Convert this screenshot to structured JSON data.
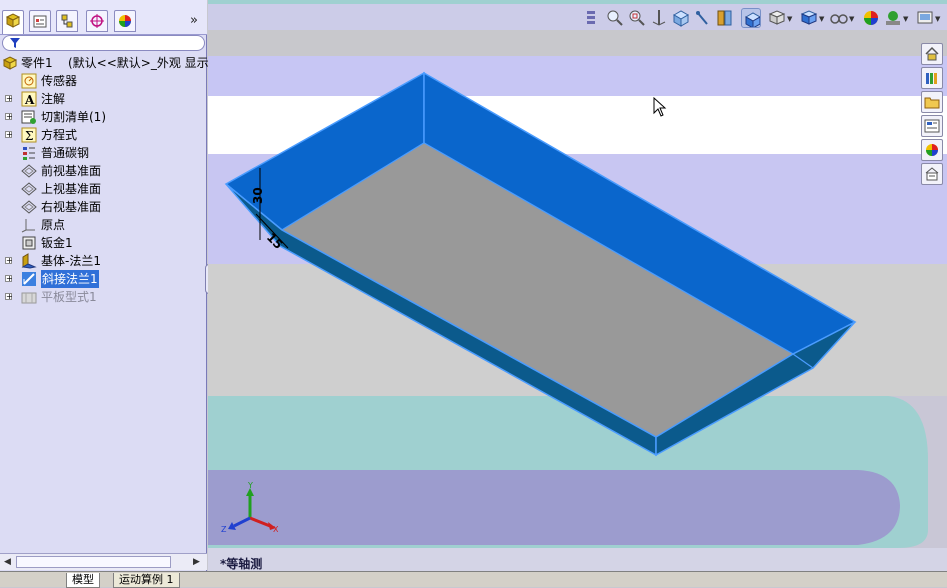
{
  "feature_tree": {
    "part_name": "零件1",
    "part_config": "(默认<<默认>_外观 显示状",
    "items": [
      {
        "label": "传感器",
        "icon": "sensor-icon"
      },
      {
        "label": "注解",
        "icon": "annotation-icon"
      },
      {
        "label": "切割清单(1)",
        "icon": "cut-list-icon"
      },
      {
        "label": "方程式",
        "icon": "equation-icon"
      },
      {
        "label": "普通碳钢",
        "icon": "material-icon"
      },
      {
        "label": "前视基准面",
        "icon": "plane-icon"
      },
      {
        "label": "上视基准面",
        "icon": "plane-icon"
      },
      {
        "label": "右视基准面",
        "icon": "plane-icon"
      },
      {
        "label": "原点",
        "icon": "origin-icon"
      },
      {
        "label": "钣金1",
        "icon": "sheet-metal-icon"
      },
      {
        "label": "基体-法兰1",
        "icon": "base-flange-icon"
      },
      {
        "label": "斜接法兰1",
        "icon": "miter-flange-icon"
      },
      {
        "label": "平板型式1",
        "icon": "flat-pattern-icon"
      }
    ],
    "expand_symbol": "+",
    "collapse_arrow": "»"
  },
  "bottom_tabs": {
    "model": "模型",
    "motion": "运动算例 1"
  },
  "viewport": {
    "view_name": "*等轴测",
    "dimension_30": "30",
    "dimension_15": "15",
    "triad": {
      "x": "X",
      "y": "Y",
      "z": "Z"
    }
  },
  "colors": {
    "panel_bg": "#dcdcf4",
    "model_blue": "#0a66cc",
    "model_edge": "#4a9cff",
    "model_floor": "#999999",
    "selection": "#3070d8"
  }
}
